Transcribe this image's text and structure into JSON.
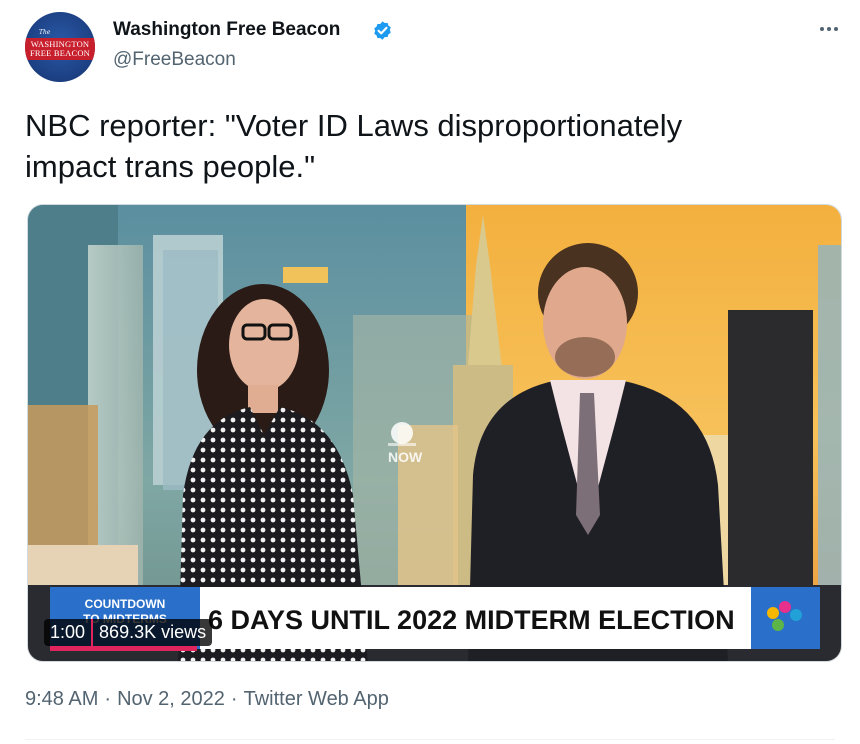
{
  "account": {
    "display_name": "Washington Free Beacon",
    "handle": "@FreeBeacon",
    "verified": true,
    "avatar_the": "The",
    "avatar_line1": "WASHINGTON",
    "avatar_line2": "FREE BEACON"
  },
  "tweet": {
    "text_line1": "NBC reporter: \"Voter ID Laws disproportionately",
    "text_line2": "impact trans people.\""
  },
  "media": {
    "banner_tag_line1": "COUNTDOWN",
    "banner_tag_line2": "TO MIDTERMS",
    "banner_headline": "6 DAYS UNTIL 2022 MIDTERM ELECTION",
    "network_bug": "NOW",
    "duration": "1:00",
    "views": "869.3K views",
    "progress_fraction": 0.18
  },
  "meta": {
    "time": "9:48 AM",
    "dot1": "·",
    "date": "Nov 2, 2022",
    "dot2": "·",
    "source": "Twitter Web App"
  },
  "colors": {
    "verified": "#1d9bf0",
    "banner_blue": "#2a6fc9",
    "progress_red": "#e0245e"
  },
  "icons": [
    "verified-badge-icon",
    "more-options-icon",
    "peacock-icon"
  ]
}
